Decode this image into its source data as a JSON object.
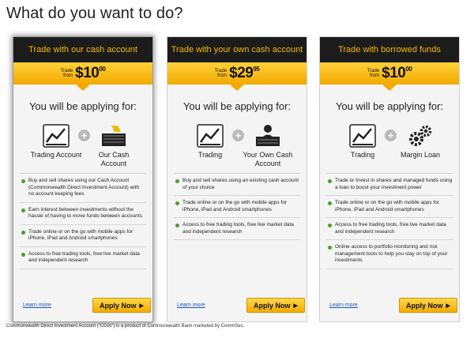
{
  "page": {
    "title": "What do you want to do?",
    "footnote": "Commonwealth Direct Investment Account (\"CDIA\") is a product of Commonwealth Bank marketed by CommSec."
  },
  "common": {
    "trade_label": "Trade",
    "from_label": "from",
    "applying_label": "You will be applying for:",
    "learn_more": "Learn more",
    "apply_now": "Apply Now"
  },
  "cards": [
    {
      "header": "Trade with our cash account",
      "price_dollars": "$10",
      "price_cents": "00",
      "icon1_label": "Trading Account",
      "icon2_label": "Our Cash Account",
      "features": [
        "Buy and sell shares using our Cash Account (Commonwealth Direct Investment Account) with no account keeping fees",
        "Earn interest between investments without the hassle of having to move funds between accounts",
        "Trade online or on the go with mobile apps for iPhone, iPad and Android smartphones",
        "Access to free trading tools, free live market data and independent research"
      ]
    },
    {
      "header": "Trade with your own cash account",
      "price_dollars": "$29",
      "price_cents": "95",
      "icon1_label": "Trading",
      "icon2_label": "Your Own Cash Account",
      "features": [
        "Buy and sell shares using an existing cash account of your choice",
        "Trade online or on the go with mobile apps for iPhone, iPad and Android smartphones",
        "Access to free trading tools, free live market data and independent research"
      ]
    },
    {
      "header": "Trade with borrowed funds",
      "price_dollars": "$10",
      "price_cents": "00",
      "icon1_label": "Trading",
      "icon2_label": "Margin Loan",
      "features": [
        "Trade or Invest in shares and managed funds using a loan to boost your investment power",
        "Trade online or on the go with mobile apps for iPhone, iPad and Android smartphones",
        "Access to free trading tools, free live market data and independent research",
        "Online access to portfolio monitoring and risk management tools to help you stay on top of your investments"
      ]
    }
  ]
}
